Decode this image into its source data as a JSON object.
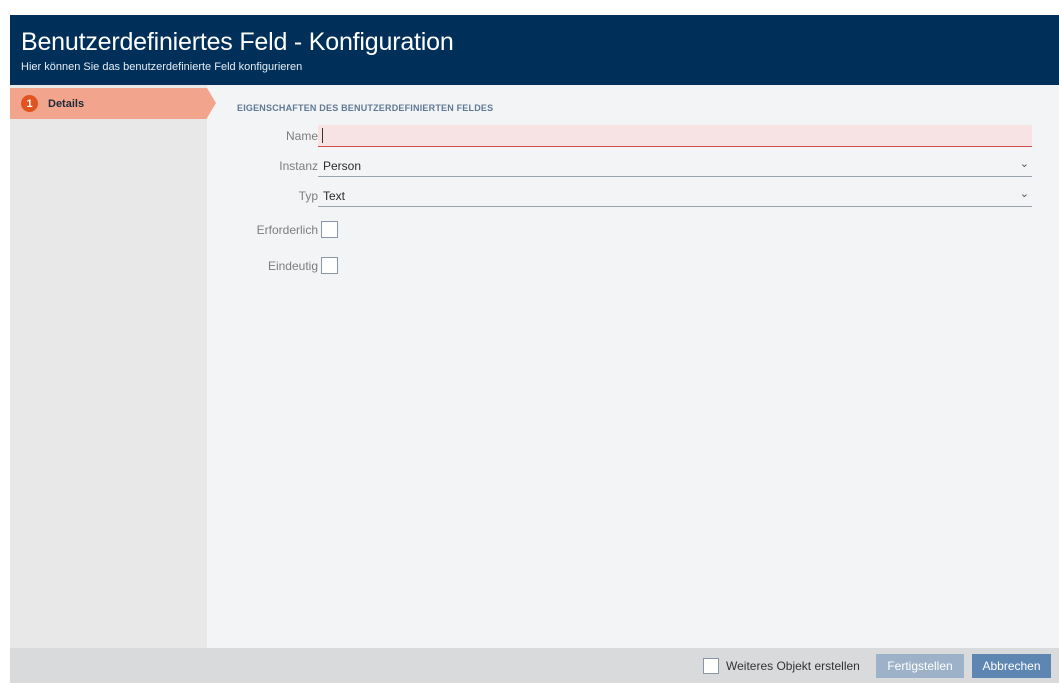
{
  "window": {
    "title": "Benutzerdefiniertes Feld - Konfiguration",
    "subtitle": "Hier können Sie das benutzerdefinierte Feld konfigurieren"
  },
  "sidebar": {
    "steps": [
      {
        "number": "1",
        "label": "Details",
        "active": true
      }
    ]
  },
  "form": {
    "section_title": "EIGENSCHAFTEN DES BENUTZERDEFINIERTEN FELDES",
    "name": {
      "label": "Name",
      "value": "",
      "state": "error"
    },
    "instanz": {
      "label": "Instanz",
      "value": "Person"
    },
    "typ": {
      "label": "Typ",
      "value": "Text"
    },
    "erforderlich": {
      "label": "Erforderlich",
      "checked": false
    },
    "eindeutig": {
      "label": "Eindeutig",
      "checked": false
    }
  },
  "footer": {
    "another_object_label": "Weiteres Objekt erstellen",
    "another_object_checked": false,
    "finish_label": "Fertigstellen",
    "cancel_label": "Abbrechen"
  },
  "colors": {
    "header_bg": "#00305a",
    "step_active_bg": "#f2a48c",
    "step_badge": "#e2541f",
    "error_field_bg": "#f7e3e3",
    "cancel_button": "#5e86b3",
    "finish_button_disabled": "#9db2c9"
  }
}
